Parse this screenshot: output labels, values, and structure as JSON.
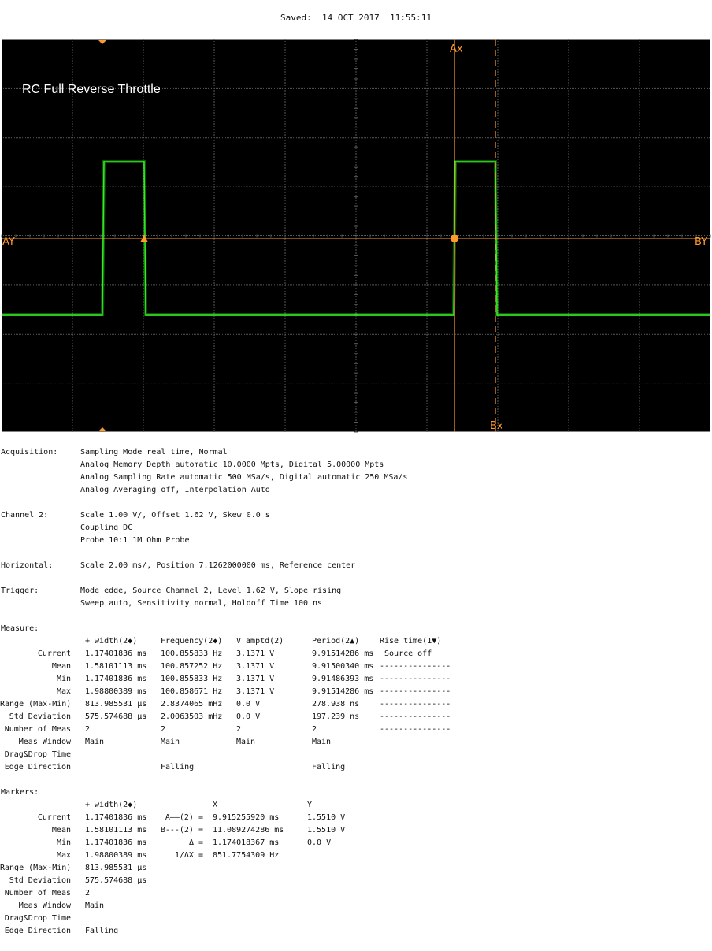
{
  "header": {
    "saved": "Saved:  14 OCT 2017  11:55:11"
  },
  "scope": {
    "title": "RC Full Reverse Throttle",
    "marker_labels": {
      "ax": "Ax",
      "bx": "Bx",
      "ay": "AY",
      "by": "BY"
    },
    "colors": {
      "background": "#000000",
      "grid": "#5a5a5a",
      "trace": "#33ee22",
      "marker": "#ff9a2e",
      "frame": "#ffffff"
    }
  },
  "acquisition": {
    "label": "Acquisition:",
    "lines": [
      "Sampling Mode real time, Normal",
      "Analog Memory Depth automatic 10.0000 Mpts, Digital 5.00000 Mpts",
      "Analog Sampling Rate automatic 500 MSa/s, Digital automatic 250 MSa/s",
      "Analog Averaging off, Interpolation Auto"
    ]
  },
  "channel2": {
    "label": "Channel 2:",
    "lines": [
      "Scale 1.00 V/, Offset 1.62 V, Skew 0.0 s",
      "Coupling DC",
      "Probe 10:1 1M Ohm Probe"
    ]
  },
  "horizontal": {
    "label": "Horizontal:",
    "lines": [
      "Scale 2.00 ms/, Position 7.1262000000 ms, Reference center"
    ]
  },
  "trigger": {
    "label": "Trigger:",
    "lines": [
      "Mode edge, Source Channel 2, Level 1.62 V, Slope rising",
      "Sweep auto, Sensitivity normal, Holdoff Time 100 ns"
    ]
  },
  "measure": {
    "label": "Measure:",
    "row_labels": [
      "Current",
      "Mean",
      "Min",
      "Max",
      "Range (Max-Min)",
      "Std Deviation",
      "Number of Meas",
      "Meas Window",
      "Drag&Drop Time",
      "Edge Direction"
    ],
    "headers": [
      "+ width(2◆)",
      "Frequency(2◆)",
      "V amptd(2)",
      "Period(2▲)",
      "Rise time(1▼)"
    ],
    "columns": [
      [
        "1.17401836 ms",
        "1.58101113 ms",
        "1.17401836 ms",
        "1.98800389 ms",
        "813.985531 µs",
        "575.574688 µs",
        "2",
        "Main",
        "",
        ""
      ],
      [
        "100.855833 Hz",
        "100.857252 Hz",
        "100.855833 Hz",
        "100.858671 Hz",
        "2.8374065 mHz",
        "2.0063503 mHz",
        "2",
        "Main",
        "",
        "Falling"
      ],
      [
        "3.1371 V",
        "3.1371 V",
        "3.1371 V",
        "3.1371 V",
        "0.0 V",
        "0.0 V",
        "2",
        "Main",
        "",
        ""
      ],
      [
        "9.91514286 ms",
        "9.91500340 ms",
        "9.91486393 ms",
        "9.91514286 ms",
        "278.938 ns",
        "197.239 ns",
        "2",
        "Main",
        "",
        "Falling"
      ],
      [
        " Source off",
        "---------------",
        "---------------",
        "---------------",
        "---------------",
        "---------------",
        "---------------",
        "",
        "",
        ""
      ]
    ]
  },
  "markers": {
    "label": "Markers:",
    "row_labels": [
      "Current",
      "Mean",
      "Min",
      "Max",
      "Range (Max-Min)",
      "Std Deviation",
      "Number of Meas",
      "Meas Window",
      "Drag&Drop Time",
      "Edge Direction"
    ],
    "width_header": "+ width(2◆)",
    "width_values": [
      "1.17401836 ms",
      "1.58101113 ms",
      "1.17401836 ms",
      "1.98800389 ms",
      "813.985531 µs",
      "575.574688 µs",
      "2",
      "Main",
      "",
      "Falling"
    ],
    "x_header": "X",
    "y_header": "Y",
    "cursor_labels": [
      "A——(2) =",
      "B---(2) =",
      "Δ =",
      "1/ΔX ="
    ],
    "x_values": [
      "9.915255920 ms",
      "11.089274286 ms",
      "1.174018367 ms",
      "851.7754309 Hz"
    ],
    "y_values": [
      "1.5510 V",
      "1.5510 V",
      "0.0 V",
      ""
    ]
  }
}
